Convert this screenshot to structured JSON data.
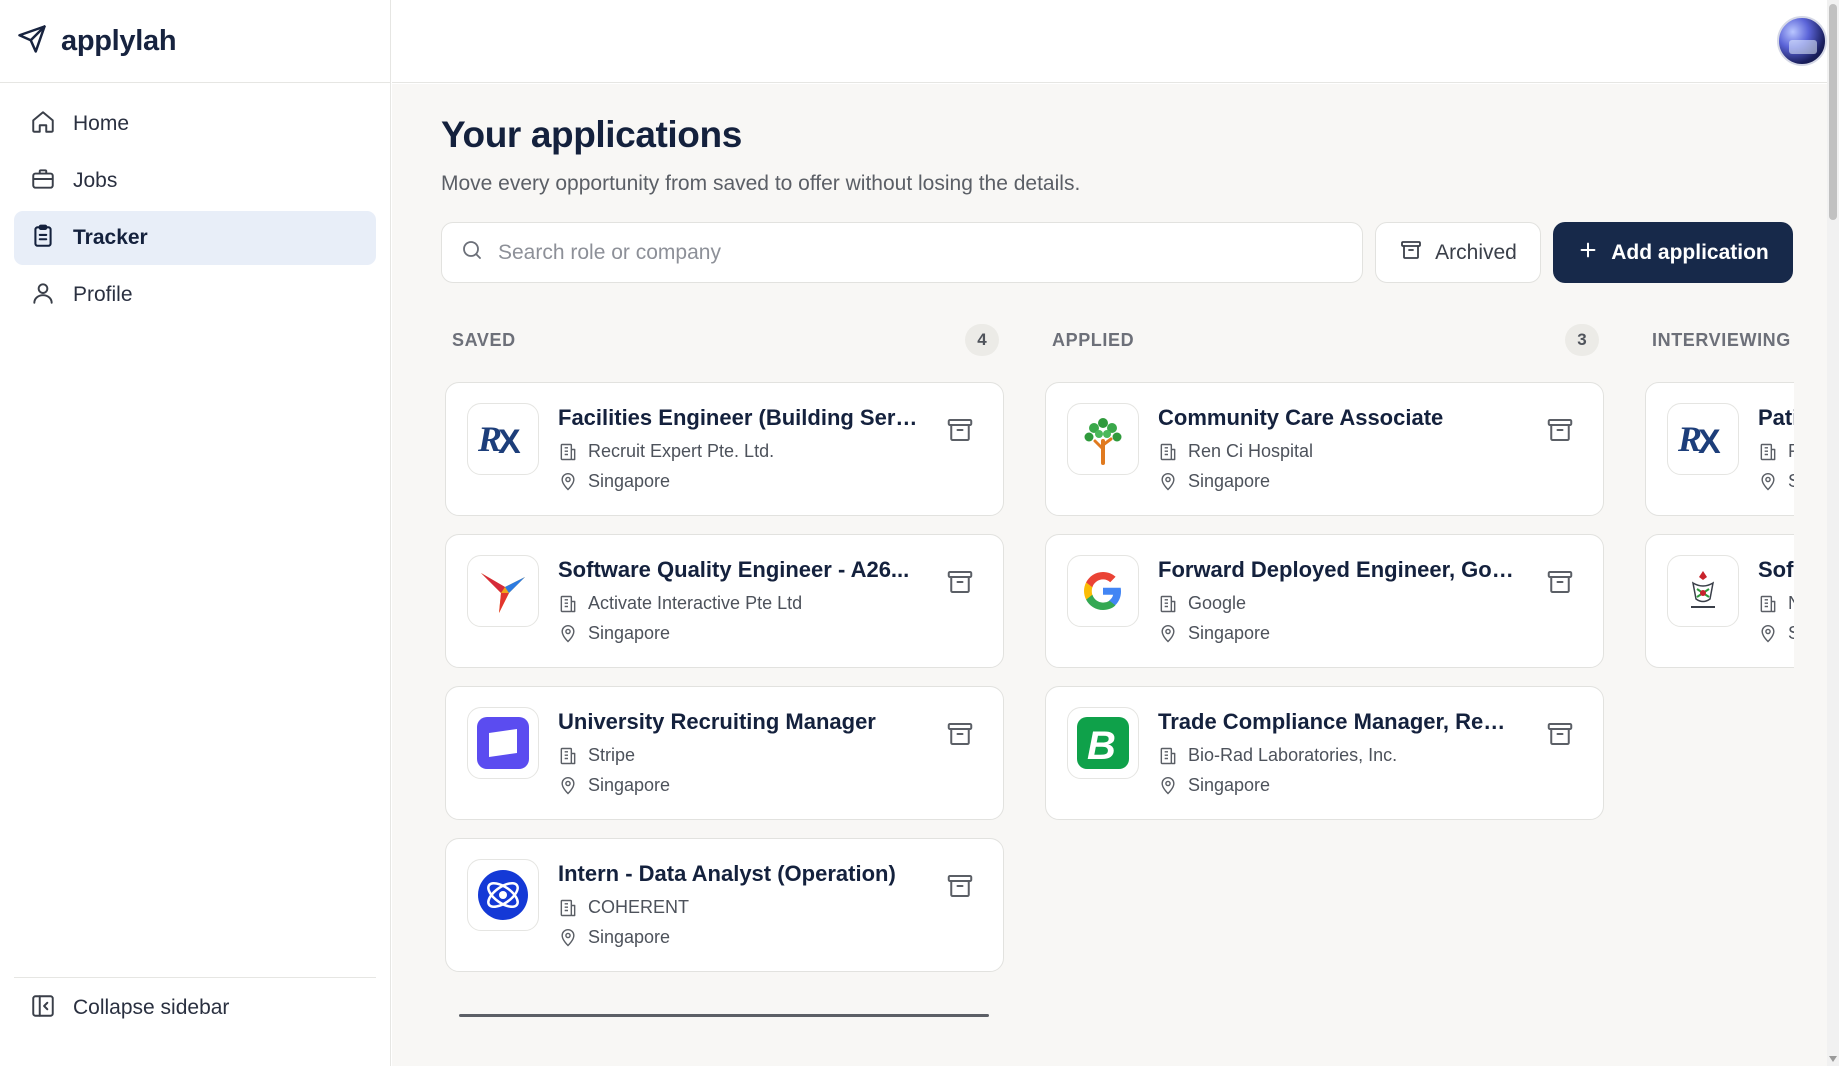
{
  "brand": {
    "name": "applylah"
  },
  "nav": {
    "items": [
      {
        "label": "Home",
        "icon": "home-icon",
        "active": false
      },
      {
        "label": "Jobs",
        "icon": "briefcase-icon",
        "active": false
      },
      {
        "label": "Tracker",
        "icon": "clipboard-icon",
        "active": true
      },
      {
        "label": "Profile",
        "icon": "user-icon",
        "active": false
      }
    ],
    "collapse_label": "Collapse sidebar"
  },
  "page": {
    "title": "Your applications",
    "subtitle": "Move every opportunity from saved to offer without losing the details."
  },
  "toolbar": {
    "search_placeholder": "Search role or company",
    "search_value": "",
    "archived_label": "Archived",
    "add_label": "Add application"
  },
  "colors": {
    "accent": "#17294a",
    "active_nav": "#e8eef8",
    "background": "#f8f7f5"
  },
  "columns": [
    {
      "title": "SAVED",
      "count": "4",
      "cards": [
        {
          "title": "Facilities Engineer (Building Serv...",
          "company": "Recruit Expert Pte. Ltd.",
          "location": "Singapore",
          "logo": "rx-logo"
        },
        {
          "title": "Software Quality Engineer - A26...",
          "company": "Activate Interactive Pte Ltd",
          "location": "Singapore",
          "logo": "activate-logo"
        },
        {
          "title": "University Recruiting Manager",
          "company": "Stripe",
          "location": "Singapore",
          "logo": "stripe-logo"
        },
        {
          "title": "Intern - Data Analyst (Operation)",
          "company": "COHERENT",
          "location": "Singapore",
          "logo": "coherent-logo"
        }
      ]
    },
    {
      "title": "APPLIED",
      "count": "3",
      "cards": [
        {
          "title": "Community Care Associate",
          "company": "Ren Ci Hospital",
          "location": "Singapore",
          "logo": "renci-logo"
        },
        {
          "title": "Forward Deployed Engineer, Goo...",
          "company": "Google",
          "location": "Singapore",
          "logo": "google-logo"
        },
        {
          "title": "Trade Compliance Manager, Regi...",
          "company": "Bio-Rad Laboratories, Inc.",
          "location": "Singapore",
          "logo": "biorad-logo"
        }
      ]
    },
    {
      "title": "INTERVIEWING",
      "count": "",
      "cards": [
        {
          "title": "Pati",
          "company": "R",
          "location": "S",
          "logo": "rx-logo"
        },
        {
          "title": "Sof",
          "company": "N",
          "location": "S",
          "logo": "crest-logo"
        }
      ]
    }
  ]
}
